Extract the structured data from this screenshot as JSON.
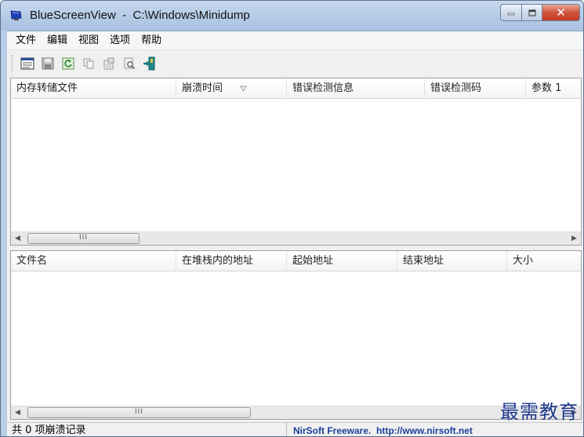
{
  "titlebar": {
    "app_name": "BlueScreenView",
    "title": "BlueScreenView  -  C:\\Windows\\Minidump",
    "icon": "monitor-bluescreen-icon",
    "minimize_icon": "minimize-icon",
    "maximize_icon": "maximize-icon",
    "close_icon": "close-icon",
    "close_glyph": "✕"
  },
  "menubar": {
    "items": [
      {
        "label": "文件"
      },
      {
        "label": "编辑"
      },
      {
        "label": "视图"
      },
      {
        "label": "选项"
      },
      {
        "label": "帮助"
      }
    ]
  },
  "toolbar": {
    "buttons": [
      {
        "icon": "html-report-icon"
      },
      {
        "icon": "save-icon"
      },
      {
        "icon": "refresh-icon"
      },
      {
        "icon": "copy-icon"
      },
      {
        "icon": "properties-icon"
      },
      {
        "icon": "find-icon"
      },
      {
        "icon": "exit-icon"
      }
    ]
  },
  "top_table": {
    "columns": [
      {
        "label": "内存转储文件"
      },
      {
        "label": "崩溃时间",
        "sorted": true
      },
      {
        "label": "错误检测信息"
      },
      {
        "label": "错误检测码"
      },
      {
        "label": "参数 1"
      }
    ],
    "rows": [],
    "scroll_thumb": "III"
  },
  "bottom_table": {
    "columns": [
      {
        "label": "文件名"
      },
      {
        "label": "在堆栈内的地址"
      },
      {
        "label": "起始地址"
      },
      {
        "label": "结束地址"
      },
      {
        "label": "大小"
      }
    ],
    "rows": [],
    "scroll_thumb": "III"
  },
  "statusbar": {
    "count_text": "共 0 项崩溃记录",
    "credit_text": "NirSoft Freeware.  http://www.nirsoft.net"
  },
  "watermark": {
    "text": "最需教育"
  },
  "colors": {
    "titlebar": "#b8cde6",
    "close_button": "#c63d24",
    "credit_text": "#1a3f9a",
    "watermark": "#1e3a8f"
  }
}
